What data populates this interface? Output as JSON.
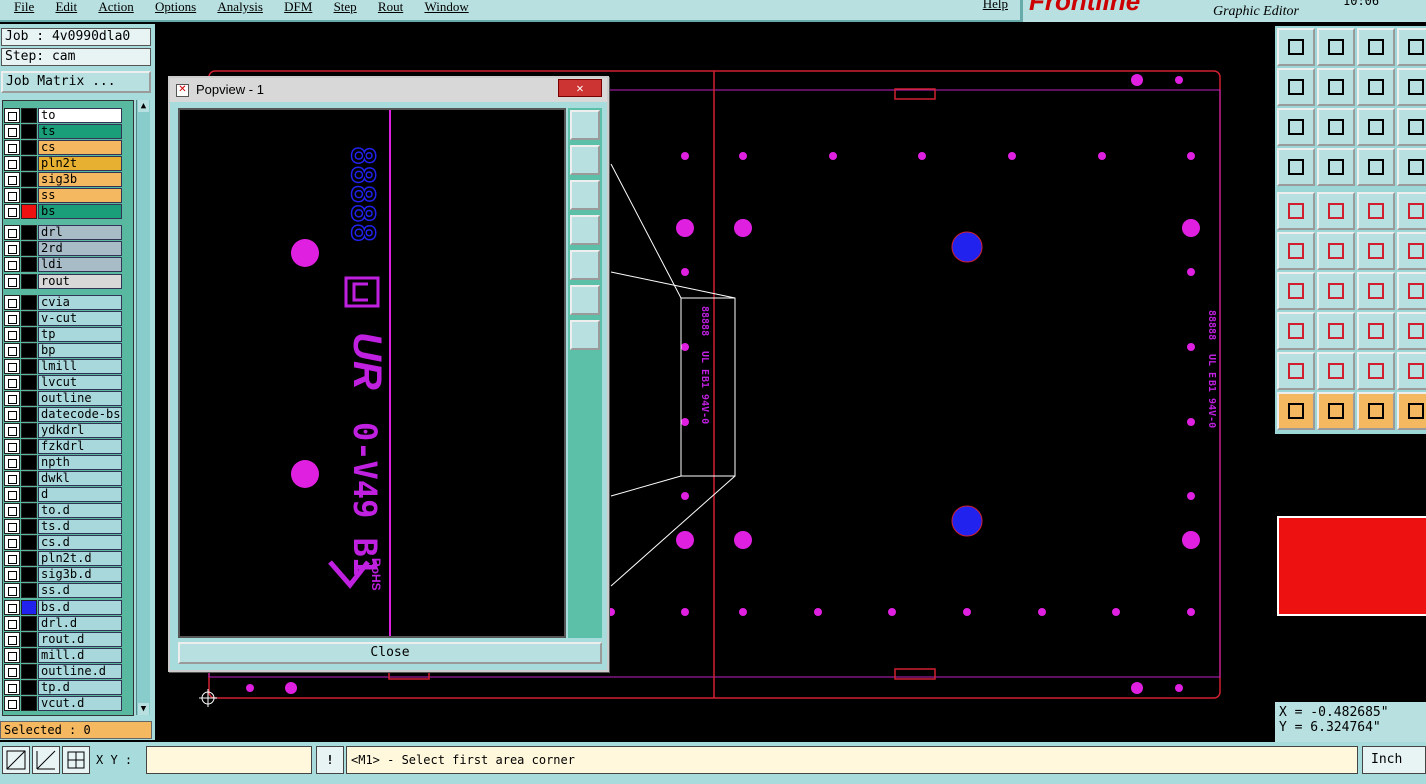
{
  "menu": {
    "items": [
      "File",
      "Edit",
      "Action",
      "Options",
      "Analysis",
      "DFM",
      "Step",
      "Rout",
      "Window"
    ],
    "help": "Help"
  },
  "brand": {
    "logo": "Frontline",
    "subtitle": "Graphic Editor",
    "time": "10:06"
  },
  "job": {
    "job_label": "Job : 4v0990dla0",
    "step_label": "Step: cam",
    "matrix_button": "Job Matrix ..."
  },
  "layers": [
    {
      "name": "to",
      "color": "#ffffff"
    },
    {
      "name": "ts",
      "color": "#1a9e7a"
    },
    {
      "name": "cs",
      "color": "#f4b860"
    },
    {
      "name": "pln2t",
      "color": "#e8b030"
    },
    {
      "name": "sig3b",
      "color": "#f4b860"
    },
    {
      "name": "ss",
      "color": "#f4b860"
    },
    {
      "name": "bs",
      "color": "#1a9e7a"
    },
    {
      "name": "drl",
      "color": "#a8bcc8"
    },
    {
      "name": "2rd",
      "color": "#a8bcc8"
    },
    {
      "name": "ldi",
      "color": "#a8bcc8"
    },
    {
      "name": "rout",
      "color": "#d8d8d8"
    },
    {
      "name": "cvia",
      "color": "#a8d8dc"
    },
    {
      "name": "v-cut",
      "color": "#a8d8dc"
    },
    {
      "name": "tp",
      "color": "#a8d8dc"
    },
    {
      "name": "bp",
      "color": "#a8d8dc"
    },
    {
      "name": "lmill",
      "color": "#a8d8dc"
    },
    {
      "name": "lvcut",
      "color": "#a8d8dc"
    },
    {
      "name": "outline",
      "color": "#a8d8dc"
    },
    {
      "name": "datecode-bs",
      "color": "#a8d8dc"
    },
    {
      "name": "ydkdrl",
      "color": "#a8d8dc"
    },
    {
      "name": "fzkdrl",
      "color": "#a8d8dc"
    },
    {
      "name": "npth",
      "color": "#a8d8dc"
    },
    {
      "name": "dwkl",
      "color": "#a8d8dc"
    },
    {
      "name": "d",
      "color": "#a8d8dc"
    },
    {
      "name": "to.d",
      "color": "#a8d8dc"
    },
    {
      "name": "ts.d",
      "color": "#a8d8dc"
    },
    {
      "name": "cs.d",
      "color": "#a8d8dc"
    },
    {
      "name": "pln2t.d",
      "color": "#a8d8dc"
    },
    {
      "name": "sig3b.d",
      "color": "#a8d8dc"
    },
    {
      "name": "ss.d",
      "color": "#a8d8dc"
    },
    {
      "name": "bs.d",
      "color": "#a8d8dc"
    },
    {
      "name": "drl.d",
      "color": "#a8d8dc"
    },
    {
      "name": "rout.d",
      "color": "#a8d8dc"
    },
    {
      "name": "mill.d",
      "color": "#a8d8dc"
    },
    {
      "name": "outline.d",
      "color": "#a8d8dc"
    },
    {
      "name": "tp.d",
      "color": "#a8d8dc"
    },
    {
      "name": "vcut.d",
      "color": "#a8d8dc"
    }
  ],
  "selected_label": "Selected : 0",
  "popview": {
    "title": "Popview - 1",
    "close_label": "Close",
    "marking_text": "0-V49 B1",
    "rohs": "RoHS",
    "datecode": "88888"
  },
  "coords": {
    "x": "X = -0.482685\"",
    "y": "Y = 6.324764\""
  },
  "bottom": {
    "xy_label": "X Y :",
    "xy_value": "",
    "exclaim": "!",
    "message": "<M1> - Select first area corner",
    "unit": "Inch"
  },
  "colors": {
    "panel": "#a8dcdc",
    "pad": "#e020e0",
    "mark_blue": "#2222ee",
    "profile": "#d02030"
  }
}
